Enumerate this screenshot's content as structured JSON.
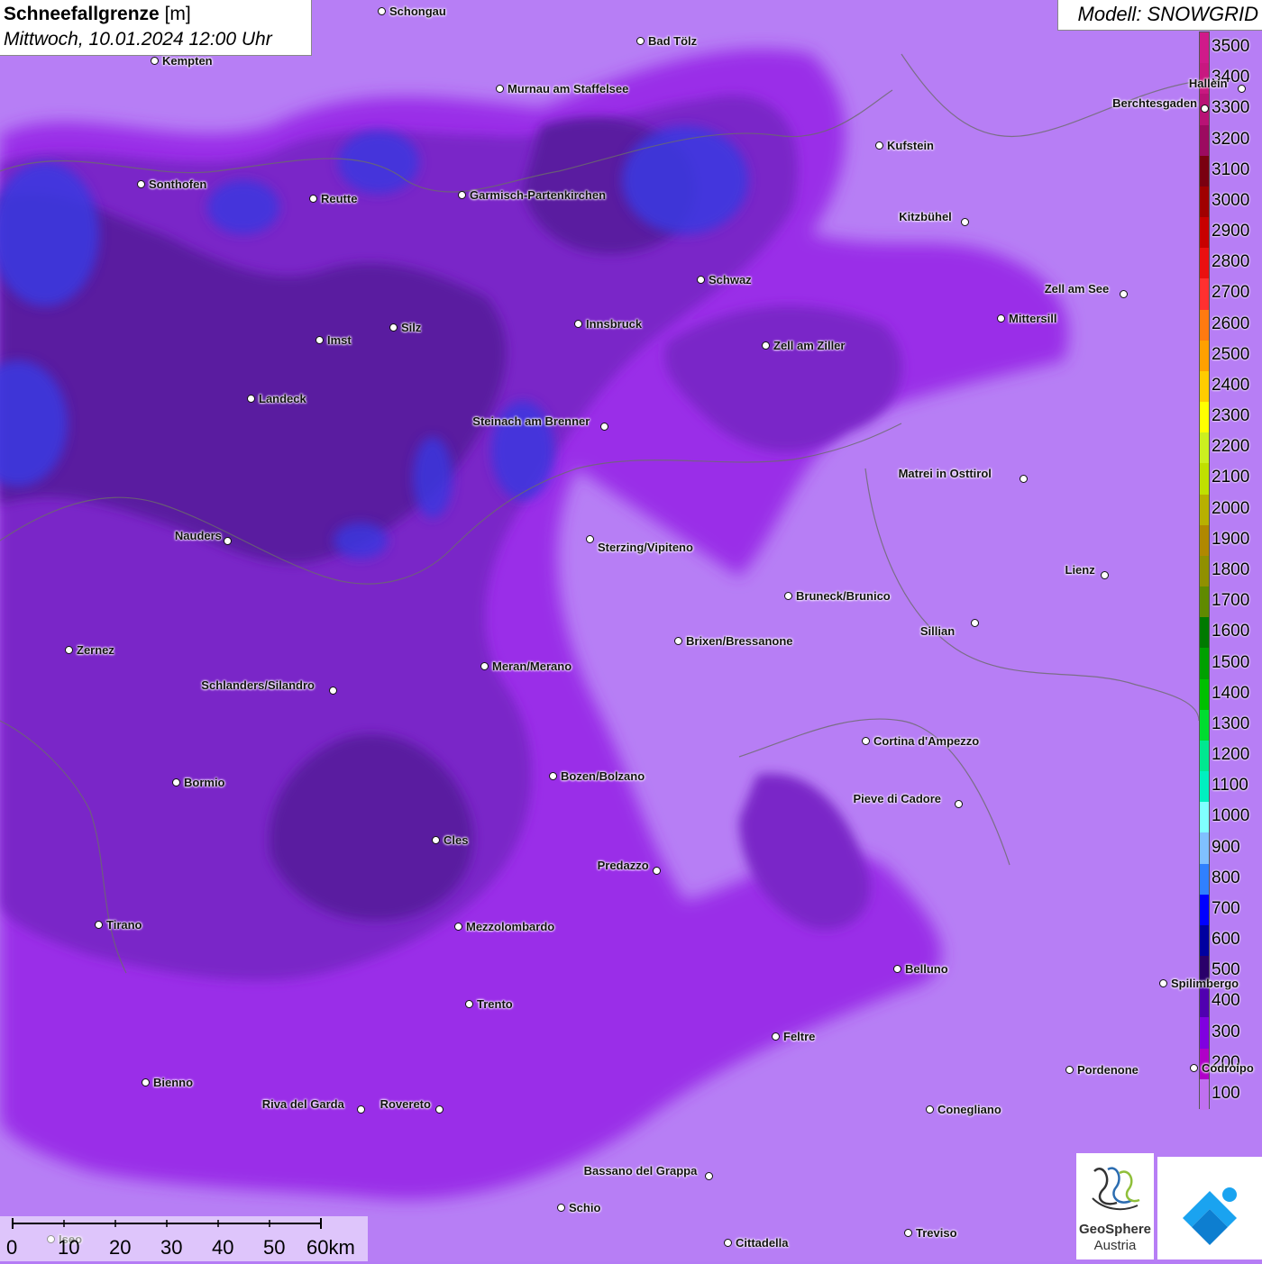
{
  "title": {
    "variable": "Schneefallgrenze",
    "unit": "[m]",
    "datetime": "Mittwoch, 10.01.2024 12:00 Uhr"
  },
  "model": "Modell: SNOWGRID",
  "legend": {
    "labels": [
      "3500",
      "3400",
      "3300",
      "3200",
      "3100",
      "3000",
      "2900",
      "2800",
      "2700",
      "2600",
      "2500",
      "2400",
      "2300",
      "2200",
      "2100",
      "2000",
      "1900",
      "1800",
      "1700",
      "1600",
      "1500",
      "1400",
      "1300",
      "1200",
      "1100",
      "1000",
      "900",
      "800",
      "700",
      "600",
      "500",
      "400",
      "300",
      "200",
      "100"
    ],
    "colors": [
      "#d01a8a",
      "#c81880",
      "#b81275",
      "#9c0a60",
      "#7a0010",
      "#a00000",
      "#c80000",
      "#ea1010",
      "#ff3030",
      "#ff7a10",
      "#ffa000",
      "#ffcc00",
      "#ffff00",
      "#ccf020",
      "#c0e000",
      "#b8b000",
      "#b08800",
      "#909000",
      "#608a00",
      "#007a00",
      "#00a000",
      "#00c000",
      "#00dc30",
      "#00e890",
      "#00f0c0",
      "#80ffff",
      "#80c0ff",
      "#3080ff",
      "#0000ff",
      "#0000a0",
      "#2a006a",
      "#5000b0",
      "#8000e0",
      "#b000c8",
      "#c070f0"
    ]
  },
  "scale": {
    "ticks": [
      "0",
      "10",
      "20",
      "30",
      "40",
      "50",
      "60km"
    ]
  },
  "logo": {
    "line1": "GeoSphere",
    "line2": "Austria"
  },
  "cities": [
    {
      "name": "Schongau"
    },
    {
      "name": "Bad Tölz"
    },
    {
      "name": "Kempten"
    },
    {
      "name": "Murnau am Staffelsee"
    },
    {
      "name": "Berchtesgaden"
    },
    {
      "name": "Hallein"
    },
    {
      "name": "Kufstein"
    },
    {
      "name": "Sonthofen"
    },
    {
      "name": "Reutte"
    },
    {
      "name": "Garmisch-Partenkirchen"
    },
    {
      "name": "Kitzbühel"
    },
    {
      "name": "Schwaz"
    },
    {
      "name": "Zell am See"
    },
    {
      "name": "Mittersill"
    },
    {
      "name": "Imst"
    },
    {
      "name": "Silz"
    },
    {
      "name": "Innsbruck"
    },
    {
      "name": "Zell am Ziller"
    },
    {
      "name": "Landeck"
    },
    {
      "name": "Steinach am Brenner"
    },
    {
      "name": "Matrei in Osttirol"
    },
    {
      "name": "Nauders"
    },
    {
      "name": "Sterzing/Vipiteno"
    },
    {
      "name": "Lienz"
    },
    {
      "name": "Bruneck/Brunico"
    },
    {
      "name": "Sillian"
    },
    {
      "name": "Zernez"
    },
    {
      "name": "Brixen/Bressanone"
    },
    {
      "name": "Meran/Merano"
    },
    {
      "name": "Schlanders/Silandro"
    },
    {
      "name": "Cortina d'Ampezzo"
    },
    {
      "name": "Bozen/Bolzano"
    },
    {
      "name": "Bormio"
    },
    {
      "name": "Pieve di Cadore"
    },
    {
      "name": "Cles"
    },
    {
      "name": "Predazzo"
    },
    {
      "name": "Tirano"
    },
    {
      "name": "Mezzolombardo"
    },
    {
      "name": "Belluno"
    },
    {
      "name": "Spilimbergo"
    },
    {
      "name": "Trento"
    },
    {
      "name": "Feltre"
    },
    {
      "name": "Pordenone"
    },
    {
      "name": "Codroipo"
    },
    {
      "name": "Bienno"
    },
    {
      "name": "Riva del Garda"
    },
    {
      "name": "Rovereto"
    },
    {
      "name": "Conegliano"
    },
    {
      "name": "Bassano del Grappa"
    },
    {
      "name": "Schio"
    },
    {
      "name": "Treviso"
    },
    {
      "name": "Cittadella"
    },
    {
      "name": "Iseo"
    }
  ]
}
